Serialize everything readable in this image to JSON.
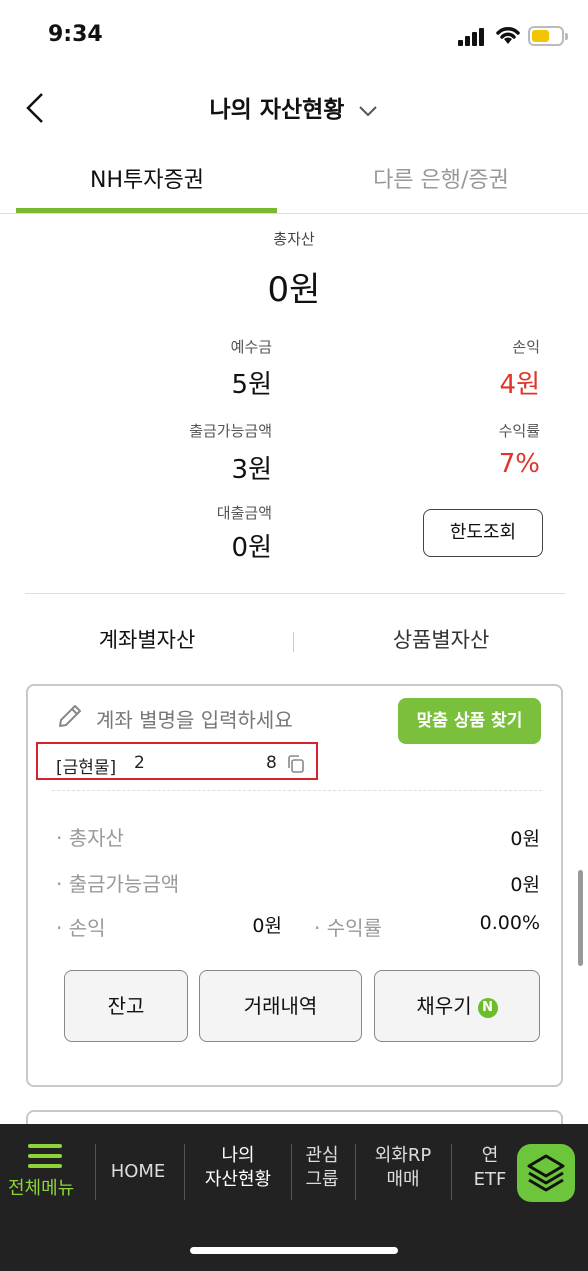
{
  "status_bar": {
    "time": "9:34"
  },
  "header": {
    "title": "나의 자산현황"
  },
  "tabs": [
    {
      "label": "NH투자증권"
    },
    {
      "label": "다른 은행/증권"
    }
  ],
  "summary": {
    "total_label": "총자산",
    "total_value": "0원",
    "deposit_label": "예수금",
    "deposit_value": "5원",
    "pnl_label": "손익",
    "pnl_value": "4원",
    "withdrawable_label": "출금가능금액",
    "withdrawable_value": "3원",
    "return_label": "수익률",
    "return_value": "7%",
    "loan_label": "대출금액",
    "loan_value": "0원",
    "limit_button": "한도조회"
  },
  "subtabs": [
    {
      "label": "계좌별자산"
    },
    {
      "label": "상품별자산"
    }
  ],
  "account_card": {
    "nickname_placeholder": "계좌 별명을 입력하세요",
    "find_button": "맞춤 상품 찾기",
    "account_type": "[금현물]",
    "account_number_start": "2",
    "account_number_end": "8",
    "rows": {
      "total_label": "· 총자산",
      "total_value": "0원",
      "withdrawable_label": "· 출금가능금액",
      "withdrawable_value": "0원",
      "pnl_label": "· 손익",
      "pnl_value": "0원",
      "return_label": "· 수익률",
      "return_value": "0.00%"
    },
    "buttons": {
      "balance": "잔고",
      "history": "거래내역",
      "fill": "채우기",
      "fill_badge": "N"
    }
  },
  "bottom_nav": {
    "menu": "전체메뉴",
    "items": [
      {
        "line1": "HOME",
        "line2": ""
      },
      {
        "line1": "나의",
        "line2": "자산현황"
      },
      {
        "line1": "관심",
        "line2": "그룹"
      },
      {
        "line1": "외화RP",
        "line2": "매매"
      },
      {
        "line1": "연",
        "line2": "ETF"
      }
    ]
  },
  "colors": {
    "accent_green": "#7ab92e",
    "loss_red": "#e0342c",
    "nav_bg": "#222222"
  }
}
